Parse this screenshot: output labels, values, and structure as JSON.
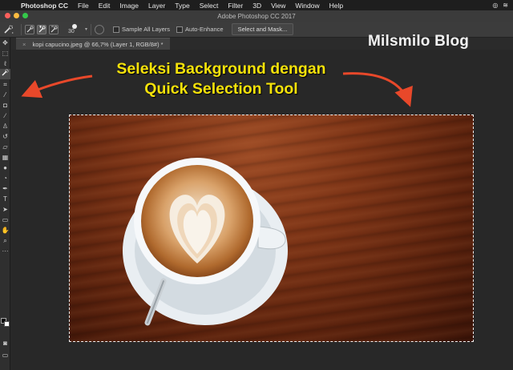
{
  "menubar": {
    "apple_icon": "apple-icon",
    "app_name": "Photoshop CC",
    "items": [
      "File",
      "Edit",
      "Image",
      "Layer",
      "Type",
      "Select",
      "Filter",
      "3D",
      "View",
      "Window",
      "Help"
    ]
  },
  "window": {
    "title": "Adobe Photoshop CC 2017"
  },
  "options_bar": {
    "brush_size": "30",
    "sample_all_layers": "Sample All Layers",
    "auto_enhance": "Auto-Enhance",
    "select_and_mask": "Select and Mask..."
  },
  "document_tab": {
    "label": "kopi capucino.jpeg @ 66,7% (Layer 1, RGB/8#) *"
  },
  "overlay": {
    "blog_name": "Milsmilo Blog",
    "headline_line1": "Seleksi Background dengan",
    "headline_line2": "Quick Selection Tool"
  },
  "colors": {
    "headline": "#f5e20a",
    "arrow": "#e8482a",
    "foreground_swatch": "#000000",
    "background_swatch": "#ffffff"
  }
}
